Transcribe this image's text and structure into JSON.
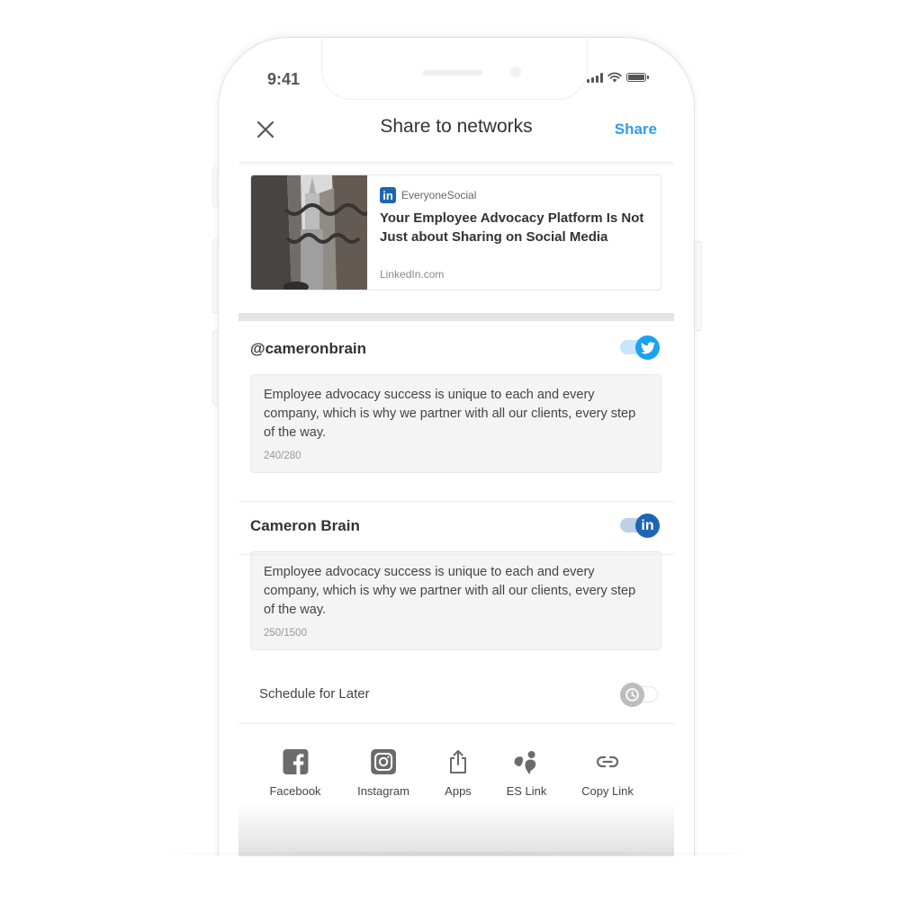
{
  "status_bar": {
    "time": "9:41",
    "icons": [
      "signal-icon",
      "wifi-icon",
      "battery-icon"
    ]
  },
  "header": {
    "close_icon": "close-icon",
    "title": "Share to networks",
    "share_label": "Share"
  },
  "preview": {
    "image": "snowy-street-photo",
    "network_icon": "linkedin-icon",
    "network_badge": "in",
    "source": "EveryoneSocial",
    "title": "Your Employee Advocacy Platform Is Not Just about Sharing on Social Media",
    "domain": "LinkedIn.com"
  },
  "accounts": [
    {
      "network": "twitter",
      "name": "@cameronbrain",
      "enabled": true,
      "toggle_color": "#1da1f2",
      "track_color": "#c8e5fb",
      "message": "Employee advocacy success is unique to each and every company, which is why we partner with all our clients, every step of the way.",
      "char_count": "240/280"
    },
    {
      "network": "linkedin",
      "name": "Cameron Brain",
      "enabled": true,
      "toggle_color": "#1e66b4",
      "track_color": "#bdd0e8",
      "badge": "in",
      "message": "Employee advocacy success is unique to each and every company, which is why we partner with all our clients, every step of the way.",
      "char_count": "250/1500"
    }
  ],
  "schedule": {
    "label": "Schedule for Later",
    "enabled": false,
    "icon": "clock-icon"
  },
  "share_options": [
    {
      "label": "Facebook",
      "icon": "facebook-icon"
    },
    {
      "label": "Instagram",
      "icon": "instagram-icon"
    },
    {
      "label": "Apps",
      "icon": "share-icon"
    },
    {
      "label": "ES Link",
      "icon": "es-logo-icon"
    },
    {
      "label": "Copy Link",
      "icon": "link-icon"
    }
  ],
  "colors": {
    "accent": "#2e9cf0",
    "icon_gray": "#6b6b6b",
    "divider": "#e4e4e4"
  }
}
